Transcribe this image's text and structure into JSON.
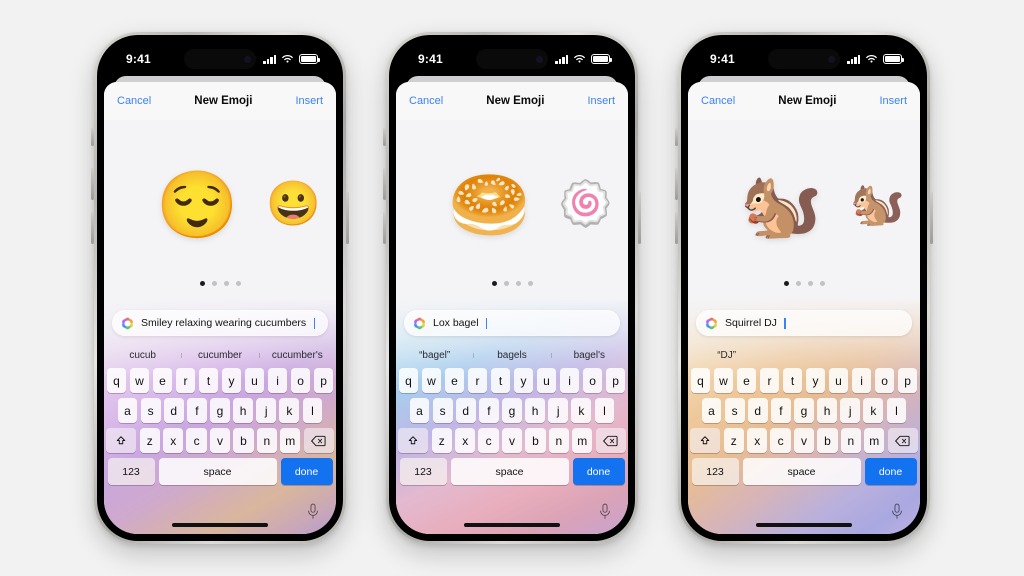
{
  "background_color": "#f2f2f2",
  "status_bar": {
    "time": "9:41",
    "signal_icon": "cellular-signal-icon",
    "wifi_icon": "wifi-icon",
    "battery_icon": "battery-icon"
  },
  "nav": {
    "cancel_label": "Cancel",
    "title": "New Emoji",
    "insert_label": "Insert"
  },
  "keyboard": {
    "row1": [
      "q",
      "w",
      "e",
      "r",
      "t",
      "y",
      "u",
      "i",
      "o",
      "p"
    ],
    "row2": [
      "a",
      "s",
      "d",
      "f",
      "g",
      "h",
      "j",
      "k",
      "l"
    ],
    "row3": [
      "z",
      "x",
      "c",
      "v",
      "b",
      "n",
      "m"
    ],
    "shift_icon": "shift-arrow-icon",
    "backspace_icon": "backspace-delete-icon",
    "numbers_label": "123",
    "space_label": "space",
    "done_label": "done",
    "mic_icon": "microphone-icon",
    "done_color": "#1272f0"
  },
  "pagination": {
    "total": 4,
    "active_index": 0
  },
  "phones": [
    {
      "id": "phone-smiley-cucumbers",
      "prompt_text": "Smiley relaxing wearing cucumbers",
      "prompt_icon": "image-playground-sparkle-icon",
      "emoji_main": "😌",
      "emoji_next": "😀",
      "suggestions": [
        "cucub",
        "cucumber",
        "cucumber's"
      ],
      "keyboard_gradient": "linear-gradient(150deg,#efe6f3 0%,#e9d7f0 14%,#d9b9ea 34%,#c9a7e0 48%,#cfa9cd 62%,#d9b69c 80%,#c9a7b8 92%,#b49ad2 100%)"
    },
    {
      "id": "phone-lox-bagel",
      "prompt_text": "Lox bagel",
      "prompt_icon": "image-playground-sparkle-icon",
      "emoji_main": "🥯",
      "emoji_next": "🍥",
      "suggestions": [
        "“bagel”",
        "bagels",
        "bagel's"
      ],
      "keyboard_gradient": "linear-gradient(155deg,#ddeef7 0%,#bfe0f2 14%,#a9cdee 28%,#c0b6e6 44%,#e3b9cf 60%,#e8aebd 74%,#dba3b6 86%,#c9a2cd 100%)"
    },
    {
      "id": "phone-squirrel-dj",
      "prompt_text": "Squirrel DJ",
      "prompt_icon": "image-playground-sparkle-icon",
      "emoji_main": "🐿️",
      "emoji_next": "🐿️",
      "suggestions": [
        "“DJ”",
        "",
        ""
      ],
      "keyboard_gradient": "linear-gradient(145deg,#f7ead8 0%,#f3d9b6 16%,#eec79a 32%,#e8bd93 46%,#d7b4b8 62%,#b9b0dd 78%,#a9a8e0 90%,#bcb0e4 100%)"
    }
  ]
}
